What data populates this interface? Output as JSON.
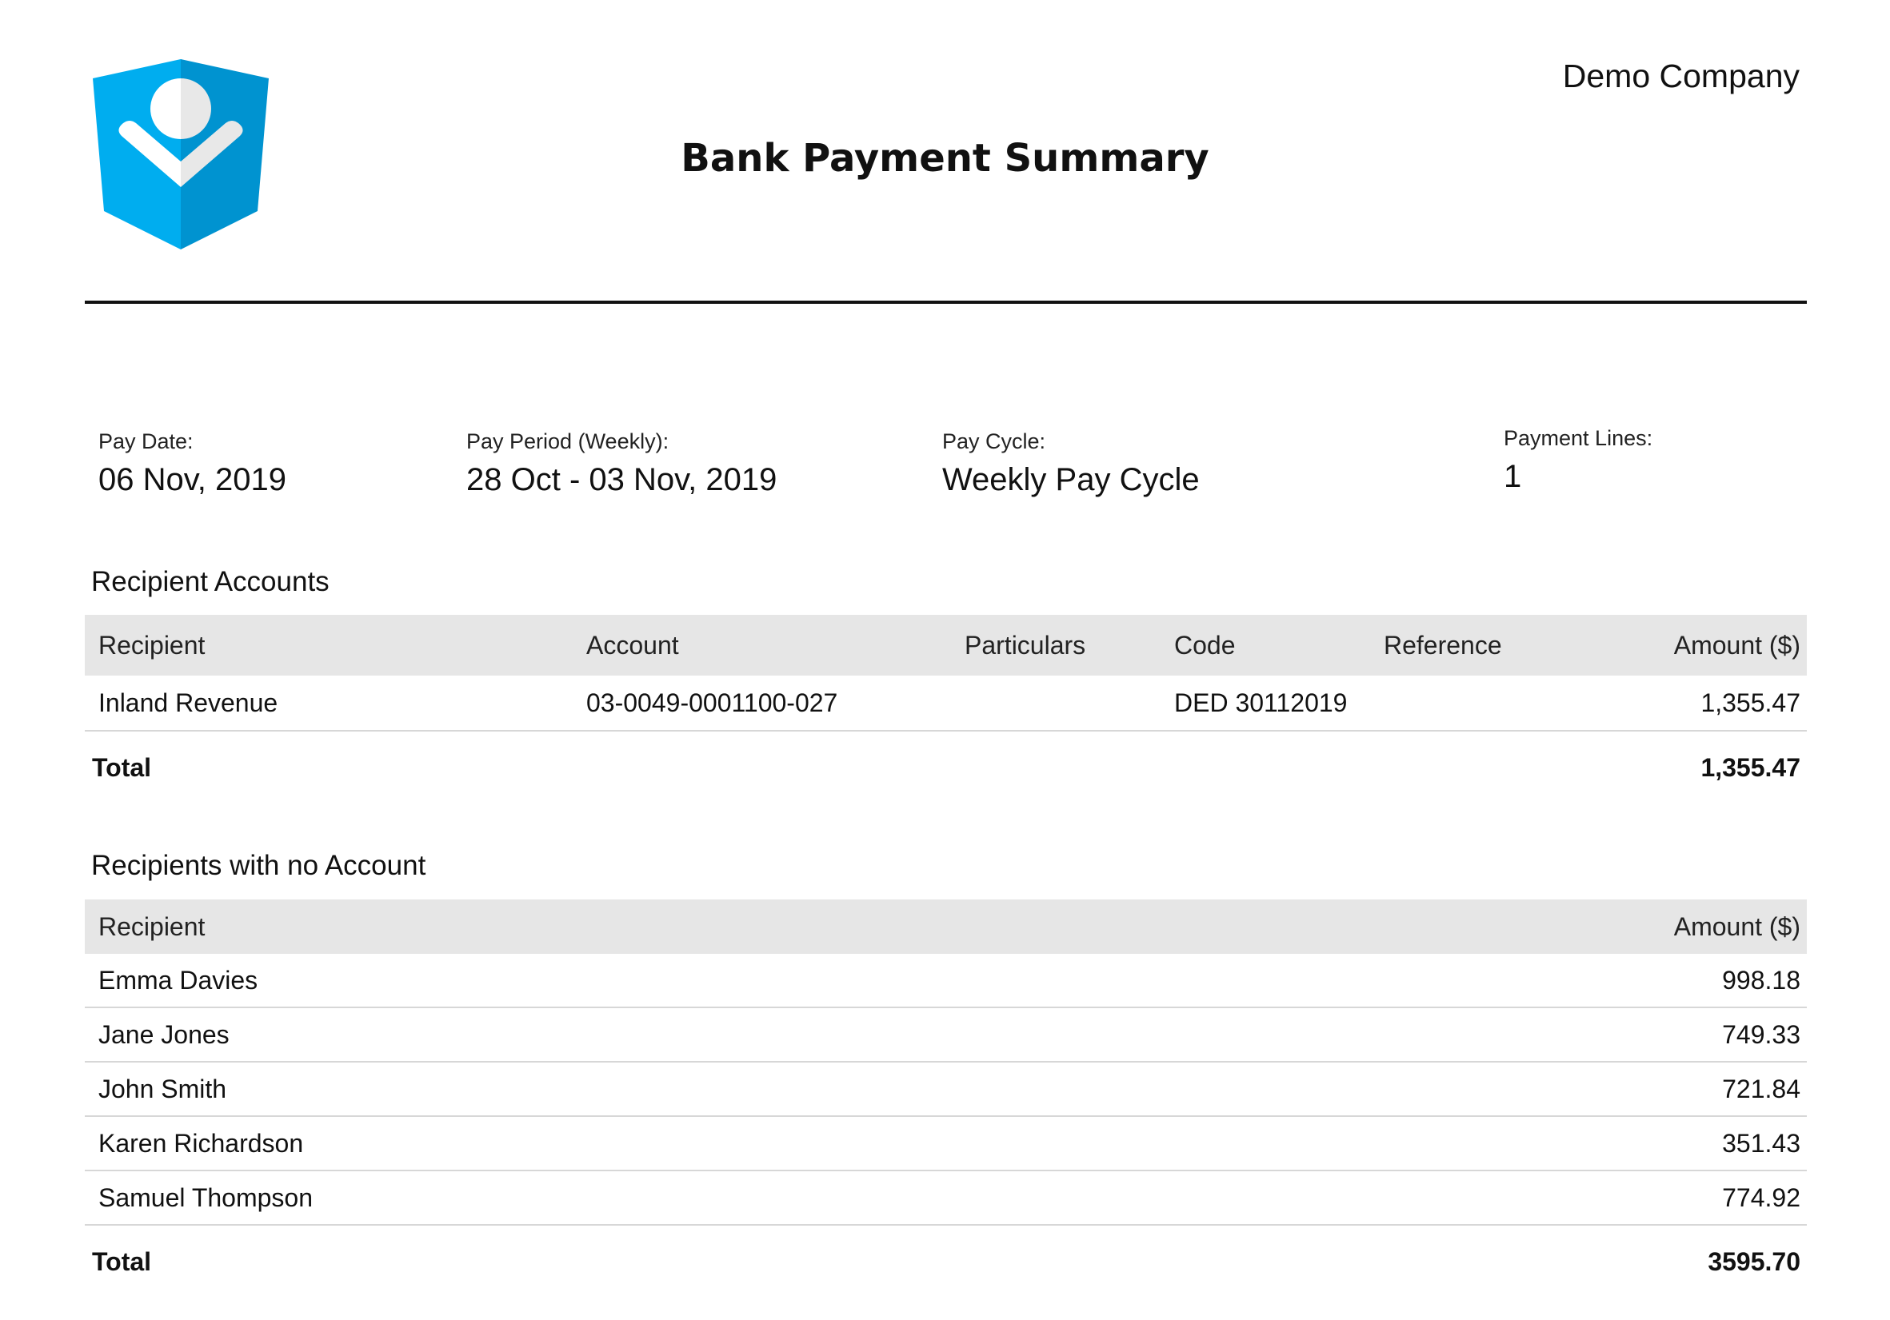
{
  "header": {
    "company": "Demo Company",
    "title": "Bank Payment Summary"
  },
  "meta": {
    "pay_date": {
      "label": "Pay Date:",
      "value": "06 Nov, 2019"
    },
    "pay_period": {
      "label": "Pay Period (Weekly):",
      "value": "28 Oct - 03 Nov, 2019"
    },
    "pay_cycle": {
      "label": "Pay Cycle:",
      "value": "Weekly Pay Cycle"
    },
    "payment_lines": {
      "label": "Payment Lines:",
      "value": "1"
    }
  },
  "recipient_accounts": {
    "title": "Recipient Accounts",
    "columns": [
      "Recipient",
      "Account",
      "Particulars",
      "Code",
      "Reference",
      "Amount ($)"
    ],
    "rows": [
      {
        "recipient": "Inland Revenue",
        "account": "03-0049-0001100-027",
        "particulars": "",
        "code": "DED 30112019",
        "reference": "",
        "amount": "1,355.47"
      }
    ],
    "total_label": "Total",
    "total": "1,355.47"
  },
  "no_account": {
    "title": "Recipients with no Account",
    "columns": [
      "Recipient",
      "Amount ($)"
    ],
    "rows": [
      {
        "recipient": "Emma Davies",
        "amount": "998.18"
      },
      {
        "recipient": "Jane Jones",
        "amount": "749.33"
      },
      {
        "recipient": "John Smith",
        "amount": "721.84"
      },
      {
        "recipient": "Karen Richardson",
        "amount": "351.43"
      },
      {
        "recipient": "Samuel Thompson",
        "amount": "774.92"
      }
    ],
    "total_label": "Total",
    "total": "3595.70"
  },
  "colors": {
    "logo_light": "#00adef",
    "logo_dark": "#0093d0",
    "header_bg": "#e6e6e6",
    "row_divider": "#d7d7d7"
  },
  "icons": {
    "logo": "shield-heart-logo-icon"
  }
}
